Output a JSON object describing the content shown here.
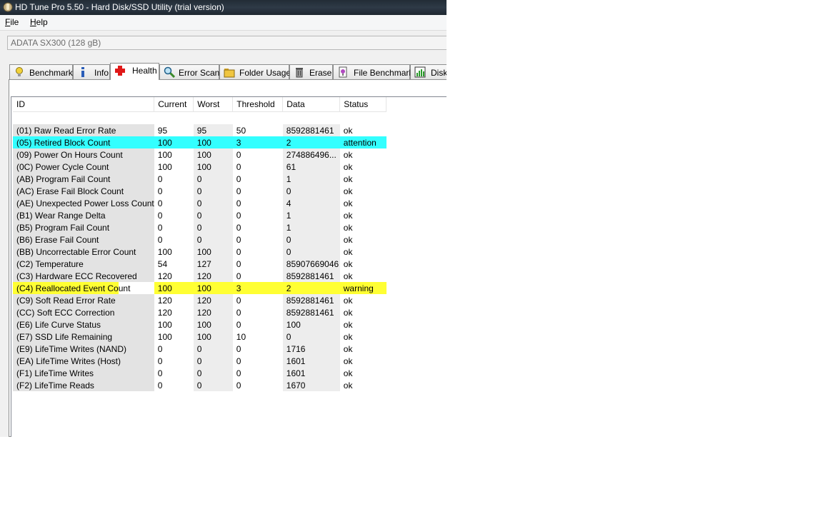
{
  "window": {
    "title": "HD Tune Pro 5.50 - Hard Disk/SSD Utility (trial version)"
  },
  "menu": [
    {
      "label": "File",
      "accel": "F",
      "rest": "ile"
    },
    {
      "label": "Help",
      "accel": "H",
      "rest": "elp"
    }
  ],
  "drive": {
    "selected": "ADATA SX300 (128 gB)"
  },
  "tabs": [
    {
      "label": "Benchmark",
      "icon": "lightbulb-icon"
    },
    {
      "label": "Info",
      "icon": "info-icon"
    },
    {
      "label": "Health",
      "icon": "red-cross-icon",
      "active": true
    },
    {
      "label": "Error Scan",
      "icon": "magnifier-icon"
    },
    {
      "label": "Folder Usage",
      "icon": "folder-icon"
    },
    {
      "label": "Erase",
      "icon": "trash-icon"
    },
    {
      "label": "File Benchmark",
      "icon": "file-benchmark-icon"
    },
    {
      "label": "Disk",
      "icon": "disk-monitor-icon"
    }
  ],
  "health": {
    "columns": [
      "ID",
      "Current",
      "Worst",
      "Threshold",
      "Data",
      "Status"
    ],
    "rows": [
      {
        "id": "(01) Raw Read Error Rate",
        "current": "95",
        "worst": "95",
        "threshold": "50",
        "data": "8592881461",
        "status": "ok"
      },
      {
        "id": "(05) Retired Block Count",
        "current": "100",
        "worst": "100",
        "threshold": "3",
        "data": "2",
        "status": "attention",
        "highlight": "cyan"
      },
      {
        "id": "(09) Power On Hours Count",
        "current": "100",
        "worst": "100",
        "threshold": "0",
        "data": "274886496...",
        "status": "ok"
      },
      {
        "id": "(0C) Power Cycle Count",
        "current": "100",
        "worst": "100",
        "threshold": "0",
        "data": "61",
        "status": "ok"
      },
      {
        "id": "(AB) Program Fail Count",
        "current": "0",
        "worst": "0",
        "threshold": "0",
        "data": "1",
        "status": "ok"
      },
      {
        "id": "(AC) Erase Fail Block Count",
        "current": "0",
        "worst": "0",
        "threshold": "0",
        "data": "0",
        "status": "ok"
      },
      {
        "id": "(AE) Unexpected Power Loss Count",
        "current": "0",
        "worst": "0",
        "threshold": "0",
        "data": "4",
        "status": "ok"
      },
      {
        "id": "(B1) Wear Range Delta",
        "current": "0",
        "worst": "0",
        "threshold": "0",
        "data": "1",
        "status": "ok"
      },
      {
        "id": "(B5) Program Fail Count",
        "current": "0",
        "worst": "0",
        "threshold": "0",
        "data": "1",
        "status": "ok"
      },
      {
        "id": "(B6) Erase Fail Count",
        "current": "0",
        "worst": "0",
        "threshold": "0",
        "data": "0",
        "status": "ok"
      },
      {
        "id": "(BB) Uncorrectable Error Count",
        "current": "100",
        "worst": "100",
        "threshold": "0",
        "data": "0",
        "status": "ok"
      },
      {
        "id": "(C2) Temperature",
        "current": "54",
        "worst": "127",
        "threshold": "0",
        "data": "85907669046",
        "status": "ok"
      },
      {
        "id": "(C3) Hardware ECC Recovered",
        "current": "120",
        "worst": "120",
        "threshold": "0",
        "data": "8592881461",
        "status": "ok"
      },
      {
        "id": "(C4) Reallocated Event Count",
        "current": "100",
        "worst": "100",
        "threshold": "3",
        "data": "2",
        "status": "warning",
        "highlight": "yellow"
      },
      {
        "id": "(C9) Soft Read Error Rate",
        "current": "120",
        "worst": "120",
        "threshold": "0",
        "data": "8592881461",
        "status": "ok"
      },
      {
        "id": "(CC) Soft ECC Correction",
        "current": "120",
        "worst": "120",
        "threshold": "0",
        "data": "8592881461",
        "status": "ok"
      },
      {
        "id": "(E6) Life Curve Status",
        "current": "100",
        "worst": "100",
        "threshold": "0",
        "data": "100",
        "status": "ok"
      },
      {
        "id": "(E7) SSD Life Remaining",
        "current": "100",
        "worst": "100",
        "threshold": "10",
        "data": "0",
        "status": "ok"
      },
      {
        "id": "(E9) LifeTime Writes (NAND)",
        "current": "0",
        "worst": "0",
        "threshold": "0",
        "data": "1716",
        "status": "ok"
      },
      {
        "id": "(EA) LifeTime Writes (Host)",
        "current": "0",
        "worst": "0",
        "threshold": "0",
        "data": "1601",
        "status": "ok"
      },
      {
        "id": "(F1) LifeTime Writes",
        "current": "0",
        "worst": "0",
        "threshold": "0",
        "data": "1601",
        "status": "ok"
      },
      {
        "id": "(F2) LifeTime Reads",
        "current": "0",
        "worst": "0",
        "threshold": "0",
        "data": "1670",
        "status": "ok"
      }
    ]
  },
  "colors": {
    "attention": "#33ffff",
    "warning": "#ffff33"
  }
}
